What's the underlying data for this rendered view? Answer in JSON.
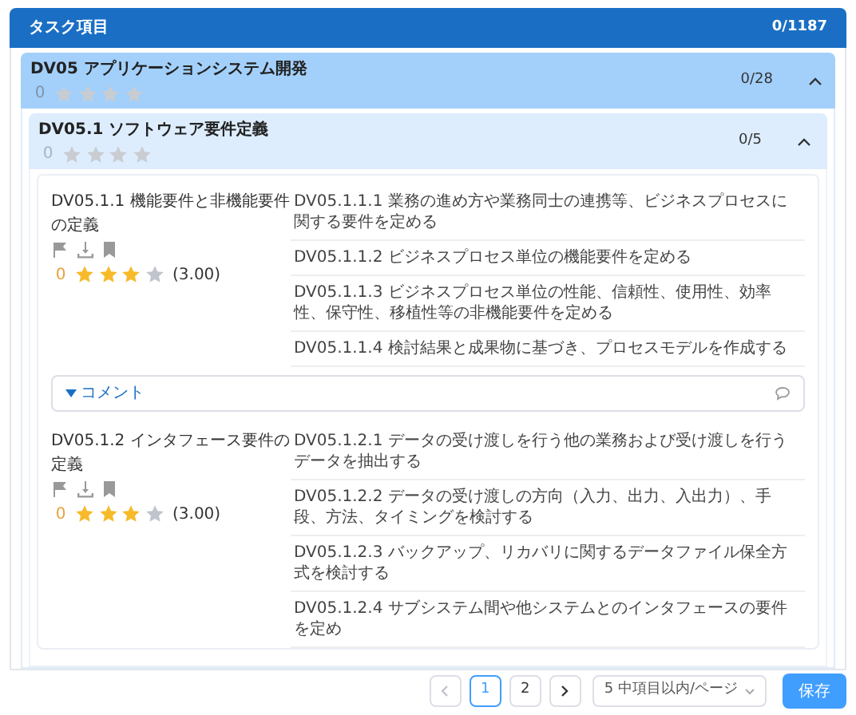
{
  "header": {
    "title": "タスク項目",
    "count": "0/1187"
  },
  "group": {
    "title": "DV05 アプリケーションシステム開発",
    "count": "0/28",
    "expanded": true,
    "rating": {
      "score": "0",
      "stars": 0
    },
    "subgroup": {
      "title": "DV05.1 ソフトウェア要件定義",
      "count": "0/5",
      "expanded": true,
      "rating": {
        "score": "0",
        "stars": 0
      },
      "items": [
        {
          "title": "DV05.1.1 機能要件と非機能要件の定義",
          "rating": {
            "score": "0",
            "stars": 3,
            "average": "(3.00)"
          },
          "tasks": [
            "DV05.1.1.1 業務の進め方や業務同士の連携等、ビジネスプロセスに関する要件を定める",
            "DV05.1.1.2 ビジネスプロセス単位の機能要件を定める",
            "DV05.1.1.3 ビジネスプロセス単位の性能、信頼性、使用性、効率性、保守性、移植性等の非機能要件を定める",
            "DV05.1.1.4 検討結果と成果物に基づき、プロセスモデルを作成する"
          ],
          "comment": {
            "label": "コメント"
          }
        },
        {
          "title": "DV05.1.2 インタフェース要件の定義",
          "rating": {
            "score": "0",
            "stars": 3,
            "average": "(3.00)"
          },
          "tasks": [
            "DV05.1.2.1 データの受け渡しを行う他の業務および受け渡しを行うデータを抽出する",
            "DV05.1.2.2 データの受け渡しの方向（入力、出力、入出力）、手段、方法、タイミングを検討する",
            "DV05.1.2.3 バックアップ、リカバリに関するデータファイル保全方式を検討する",
            "DV05.1.2.4 サブシステム間や他システムとのインタフェースの要件を定め"
          ]
        }
      ]
    }
  },
  "pagination": {
    "prev_disabled": true,
    "next_disabled": false,
    "pages": [
      {
        "label": "1",
        "selected": true
      },
      {
        "label": "2",
        "selected": false
      }
    ]
  },
  "page_size": "5 中項目以内/ページ",
  "save_button": "保存"
}
